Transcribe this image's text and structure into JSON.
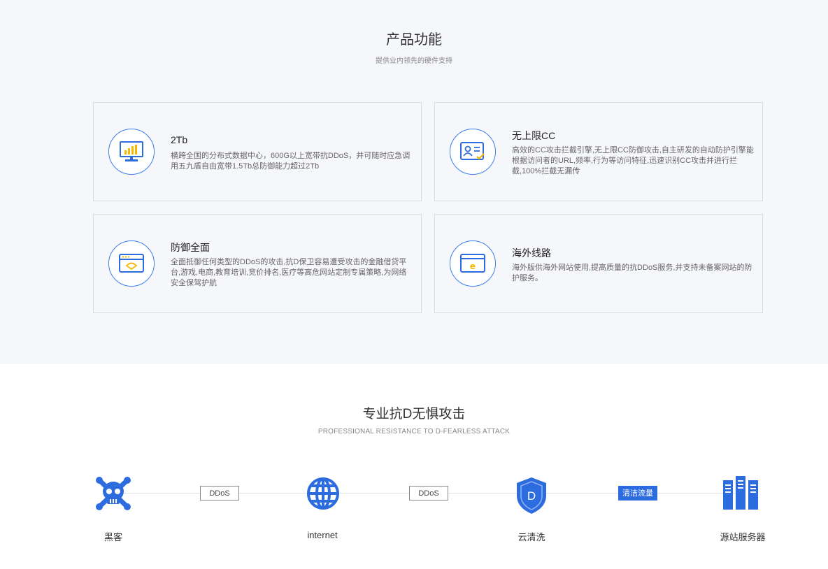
{
  "features": {
    "title": "产品功能",
    "subtitle": "提供业内领先的硬件支持",
    "cards": [
      {
        "icon": "monitor-chart-icon",
        "title": "2Tb",
        "desc": "横跨全国的分布式数据中心，600G以上宽带抗DDoS，并可随时应急调用五九盾自由宽带1.5Tb总防御能力超过2Tb"
      },
      {
        "icon": "id-card-check-icon",
        "title": "无上限CC",
        "desc": "高效的CC攻击拦截引擎,无上限CC防御攻击,自主研发的自动防护引擎能根据访问者的URL,频率,行为等访问特征,迅速识别CC攻击并进行拦截,100%拦截无漏传"
      },
      {
        "icon": "browser-shield-icon",
        "title": "防御全面",
        "desc": "全面抵御任何类型的DDoS的攻击,抗D保卫容易遭受攻击的金融借贷平台,游戏,电商,教育培训,竞价排名,医疗等高危网站定制专属策略,为网络安全保驾护航"
      },
      {
        "icon": "browser-e-icon",
        "title": "海外线路",
        "desc": "海外版供海外网站使用,提高质量的抗DDoS服务,并支持未备案网站的防护服务。"
      }
    ]
  },
  "attack": {
    "title": "专业抗D无惧攻击",
    "subtitle": "PROFESSIONAL RESISTANCE TO D-FEARLESS ATTACK",
    "nodes": [
      {
        "icon": "skull-crossbones-icon",
        "label": "黑客"
      },
      {
        "icon": "globe-icon",
        "label": "internet"
      },
      {
        "icon": "shield-d-icon",
        "label": "云清洗"
      },
      {
        "icon": "server-rack-icon",
        "label": "源站服务器"
      }
    ],
    "tags": [
      "DDoS",
      "DDoS",
      "清洁流量"
    ]
  },
  "colors": {
    "accent": "#2d6cdf",
    "yellow": "#f5b700",
    "bg": "#f6f7fb"
  }
}
